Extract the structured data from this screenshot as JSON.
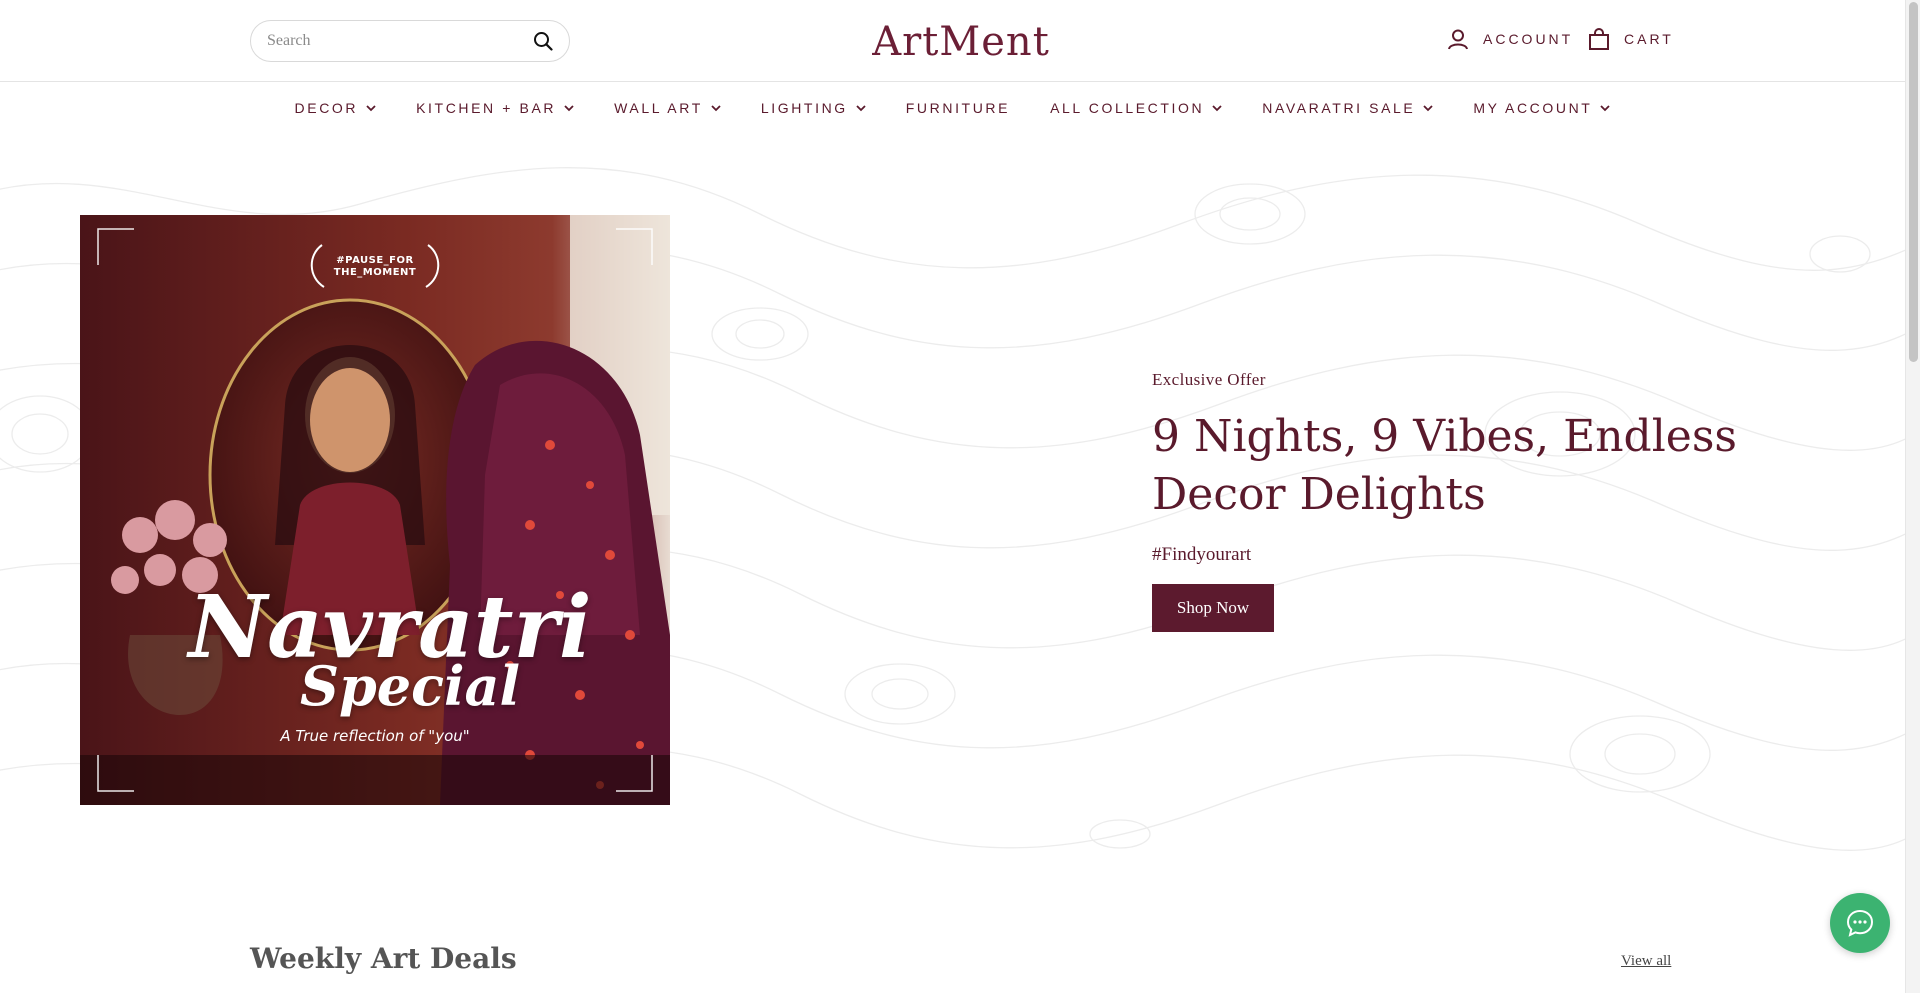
{
  "header": {
    "search_placeholder": "Search",
    "logo_text": "ArtMent",
    "account_label": "ACCOUNT",
    "cart_label": "CART"
  },
  "nav": {
    "items": [
      {
        "label": "DECOR",
        "icon": "chevron-down-icon"
      },
      {
        "label": "KITCHEN + BAR",
        "icon": "chevron-down-icon"
      },
      {
        "label": "WALL ART",
        "icon": "chevron-down-icon"
      },
      {
        "label": "LIGHTING",
        "icon": "chevron-down-icon"
      },
      {
        "label": "FURNITURE"
      },
      {
        "label": "ALL COLLECTION",
        "icon": "chevron-down-icon"
      },
      {
        "label": "NAVARATRI SALE",
        "icon": "chevron-down-icon"
      },
      {
        "label": "MY ACCOUNT",
        "icon": "chevron-down-icon"
      }
    ]
  },
  "hero": {
    "image": {
      "tag_line1": "#PAUSE_FOR",
      "tag_line2": "THE_MOMENT",
      "title_line1": "Navratri",
      "title_line2": "Special",
      "subtitle": "A True reflection of \"you\""
    },
    "eyebrow": "Exclusive Offer",
    "headline": "9 Nights, 9 Vibes, Endless Decor Delights",
    "hashtag": "#Findyourart",
    "cta_label": "Shop Now"
  },
  "deals": {
    "title": "Weekly Art Deals",
    "view_all": "View all"
  },
  "colors": {
    "brand": "#5c1a2e",
    "chat_button": "#3cb371"
  }
}
